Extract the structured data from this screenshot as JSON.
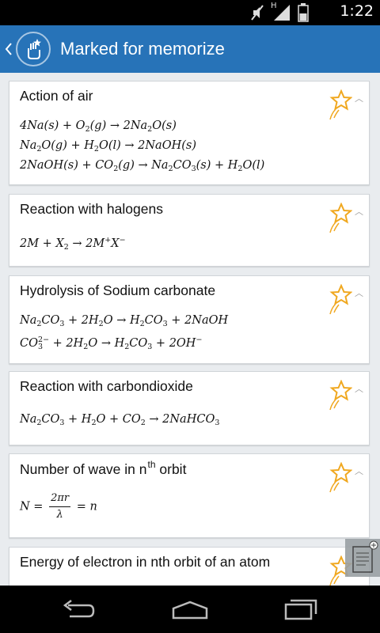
{
  "status_bar": {
    "time": "1:22",
    "network_label": "H"
  },
  "action_bar": {
    "title": "Marked for memorize"
  },
  "cards": [
    {
      "title": "Action of air",
      "formula_lines": [
        "4Na(s) + O2(g) → 2Na2O(s)",
        "Na2O(g) + H2O(l) → 2NaOH(s)",
        "2NaOH(s) + CO2(g) → Na2CO3(s) + H2O(l)"
      ]
    },
    {
      "title": "Reaction with halogens",
      "formula_lines": [
        "2M + X2 → 2M+X−"
      ]
    },
    {
      "title": "Hydrolysis of Sodium carbonate",
      "formula_lines": [
        "Na2CO3 + 2H2O → H2CO3 + 2NaOH",
        "CO3 2− + 2H2O → H2CO3 + 2OH−"
      ]
    },
    {
      "title": "Reaction with carbondioxide",
      "formula_lines": [
        "Na2CO3 + H2O + CO2 → 2NaHCO3"
      ]
    },
    {
      "title_main": "Number of wave in n",
      "title_sup": "th",
      "title_end": "orbit",
      "formula_lines": [
        "N = 2πr / λ = n"
      ]
    },
    {
      "title": "Energy of electron in nth orbit of an atom"
    }
  ],
  "icons": [
    "back-icon",
    "app-logo-icon",
    "star-icon",
    "chevron-up-icon",
    "note-add-icon",
    "back-nav-icon",
    "home-nav-icon",
    "recents-nav-icon",
    "mute-icon",
    "signal-icon",
    "battery-icon"
  ]
}
